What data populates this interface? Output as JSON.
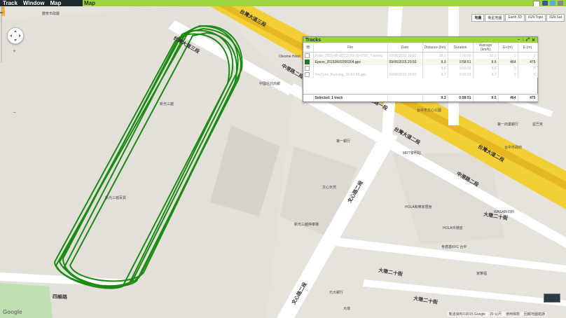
{
  "menu": {
    "items": [
      "Track",
      "Window",
      "Map"
    ],
    "active_tab": "Map"
  },
  "colors": {
    "accent": "#9bd43c",
    "menubar": "#1f2a2e",
    "track": "#1a8a13",
    "highway": "#f3cf36",
    "road": "#ffffff",
    "green_area": "#bfe0b0"
  },
  "map_types": [
    "地圖",
    "衛星地圖",
    "Earth 3D",
    "IGN Topo",
    "IGN Sat"
  ],
  "road_labels": {
    "r1": "台灣大道三段",
    "r2": "台灣大道二段",
    "r3": "中港路二段",
    "r4": "中港路一段",
    "r5": "中港路二段",
    "r6": "文心路二段",
    "r7": "文心路二段",
    "r8": "大墩二十街",
    "r9": "大墩二十街",
    "r10": "台灣大道三段",
    "r11": "台灣大道二段",
    "r12": "四維路",
    "r13": "大墩二十街"
  },
  "poi_labels": {
    "p1": "體育市政廳",
    "p2": "Oleome Hotel",
    "p3": "中國信託商銀",
    "p4": "台中市文心公園",
    "p5": "第一商業銀行",
    "p6": "台中市政府",
    "p7": "新光三越",
    "p8": "文心天然",
    "p9": "MRT黎明站",
    "p10": "HOLA和樂家居館",
    "p11": "WASABI日料",
    "p12": "HOLA中港店",
    "p13": "肯德基KFC 台中",
    "p14": "家樂福",
    "p15": "第一銀行",
    "p16": "新光三越百貨",
    "p17": "元大銀行",
    "p18": "大墩",
    "p19": "新光三越停車場",
    "p20": "星巴克"
  },
  "tracks_window": {
    "title": "Tracks",
    "columns": [
      "",
      "File",
      "Date",
      "Distance (km)",
      "Duration",
      "Average (km/h)",
      "E+(m)",
      "E-(m)"
    ],
    "rows": [
      {
        "checked": false,
        "file": "Polar_2015-06-09T12-03-09-0000_Training",
        "date": "09/06/2015 20:03",
        "distance": "10.2",
        "duration": "1:00:00",
        "average": "10.2",
        "eplus": "0",
        "eminus": "0",
        "dim": true
      },
      {
        "checked": true,
        "file": "Epson_20150609200304.gpx",
        "date": "09/06/2015 20:03",
        "distance": "9.3",
        "duration": "0:58:51",
        "average": "9.5",
        "eplus": "464",
        "eminus": "475",
        "dim": false
      },
      {
        "checked": false,
        "file": "",
        "date": "",
        "distance": "9.8",
        "duration": "0:59:58",
        "average": "9.8",
        "eplus": "0",
        "eminus": "0",
        "dim": true
      },
      {
        "checked": false,
        "file": "YouTube_Running_20-03-06.gpx",
        "date": "09/06/2015 20:03",
        "distance": "9.7",
        "duration": "0:59:02",
        "average": "9.7",
        "eplus": "0",
        "eminus": "0",
        "dim": true
      }
    ],
    "footer": {
      "label": "Selected: 1 track",
      "distance": "9.3",
      "duration": "0:58:51",
      "average": "9.5",
      "eplus": "464",
      "eminus": "475"
    }
  },
  "attribution": {
    "data": "軌道資料©2015 Google",
    "scale": "20 公尺",
    "terms": "使用條款",
    "report": "回報地圖錯誤"
  },
  "google_logo": "Google"
}
